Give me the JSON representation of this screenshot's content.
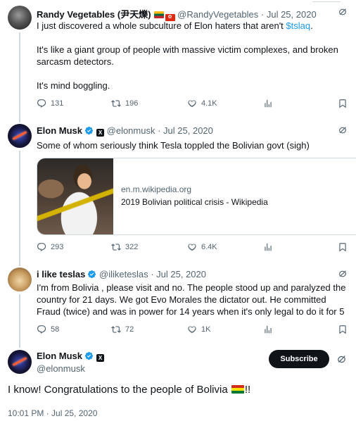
{
  "tweets": [
    {
      "name": "Randy Vegetables (尹天爍)",
      "handle": "@RandyVegetables",
      "date": "· Jul 25, 2020",
      "text": [
        "I just discovered a whole subculture of Elon haters that aren't ",
        "$tslaq",
        ".",
        "It's like a giant group of people with massive victim complexes, and broken sarcasm detectors.",
        "It's mind boggling."
      ],
      "replies": "131",
      "retweets": "196",
      "likes": "4.1K"
    },
    {
      "name": "Elon Musk",
      "handle": "@elonmusk",
      "date": "· Jul 25, 2020",
      "text": "Some of whom seriously think Tesla toppled the Bolivian govt (sigh)",
      "card": {
        "domain": "en.m.wikipedia.org",
        "title": "2019 Bolivian political crisis - Wikipedia"
      },
      "replies": "293",
      "retweets": "322",
      "likes": "6.4K"
    },
    {
      "name": "i like teslas",
      "handle": "@iliketeslas",
      "date": "· Jul 25, 2020",
      "text": "I'm from Bolivia , please visit and no. The people stood up and paralyzed the country for 21 days. We got Evo Morales the dictator out. He committed Fraud (twice) and was in power for 14 years when it's only legal to do it for 5",
      "replies": "58",
      "retweets": "72",
      "likes": "1K"
    }
  ],
  "main": {
    "name": "Elon Musk",
    "handle": "@elonmusk",
    "subscribe": "Subscribe",
    "text_before": "I know! Congratulations to the people of Bolivia ",
    "text_after": "!!",
    "timestamp": "10:01 PM · Jul 25, 2020"
  },
  "colors": {
    "link": "#1d9bf0",
    "verified": "#1d9bf0",
    "secondary": "#536471"
  },
  "icons": [
    "reply-icon",
    "retweet-icon",
    "like-icon",
    "views-icon",
    "bookmark-icon",
    "grok-icon",
    "verified-icon",
    "x-badge-icon"
  ]
}
